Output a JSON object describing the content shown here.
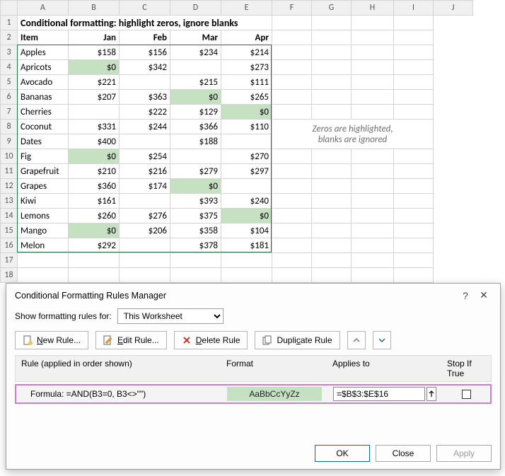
{
  "title": "Conditional formatting: highlight zeros, ignore blanks",
  "cols": [
    "A",
    "B",
    "C",
    "D",
    "E",
    "F",
    "G",
    "H",
    "I",
    "J"
  ],
  "months_header": {
    "item": "Item",
    "jan": "Jan",
    "feb": "Feb",
    "mar": "Mar",
    "apr": "Apr"
  },
  "note_line1": "Zeros are highlighted,",
  "note_line2": "blanks are ignored",
  "rows": [
    {
      "n": 3,
      "item": "Apples",
      "jan": "$158",
      "feb": "$156",
      "mar": "$234",
      "apr": "$214"
    },
    {
      "n": 4,
      "item": "Apricots",
      "jan": "$0",
      "jan_z": true,
      "feb": "$342",
      "mar": "",
      "apr": "$273"
    },
    {
      "n": 5,
      "item": "Avocado",
      "jan": "$221",
      "feb": "",
      "mar": "$215",
      "apr": "$111"
    },
    {
      "n": 6,
      "item": "Bananas",
      "jan": "$207",
      "feb": "$363",
      "mar": "$0",
      "mar_z": true,
      "apr": "$265"
    },
    {
      "n": 7,
      "item": "Cherries",
      "jan": "",
      "feb": "$222",
      "mar": "$129",
      "apr": "$0",
      "apr_z": true
    },
    {
      "n": 8,
      "item": "Coconut",
      "jan": "$331",
      "feb": "$244",
      "mar": "$366",
      "apr": "$110"
    },
    {
      "n": 9,
      "item": "Dates",
      "jan": "$400",
      "feb": "",
      "mar": "$188",
      "apr": ""
    },
    {
      "n": 10,
      "item": "Fig",
      "jan": "$0",
      "jan_z": true,
      "feb": "$254",
      "mar": "",
      "apr": "$270"
    },
    {
      "n": 11,
      "item": "Grapefruit",
      "jan": "$210",
      "feb": "$216",
      "mar": "$279",
      "apr": "$297"
    },
    {
      "n": 12,
      "item": "Grapes",
      "jan": "$360",
      "feb": "$174",
      "mar": "$0",
      "mar_z": true,
      "apr": ""
    },
    {
      "n": 13,
      "item": "Kiwi",
      "jan": "$161",
      "feb": "",
      "mar": "$393",
      "apr": "$240"
    },
    {
      "n": 14,
      "item": "Lemons",
      "jan": "$260",
      "feb": "$276",
      "mar": "$375",
      "apr": "$0",
      "apr_z": true
    },
    {
      "n": 15,
      "item": "Mango",
      "jan": "$0",
      "jan_z": true,
      "feb": "$206",
      "mar": "$358",
      "apr": "$104"
    },
    {
      "n": 16,
      "item": "Melon",
      "jan": "$292",
      "feb": "",
      "mar": "$378",
      "apr": "$181"
    }
  ],
  "dialog": {
    "title": "Conditional Formatting Rules Manager",
    "show_label": "Show formatting rules for:",
    "show_value": "This Worksheet",
    "new_rule": "New Rule...",
    "edit_rule": "Edit Rule...",
    "delete_rule": "Delete Rule",
    "duplicate_rule": "Duplicate Rule",
    "hdr_rule": "Rule (applied in order shown)",
    "hdr_format": "Format",
    "hdr_applies": "Applies to",
    "hdr_stop": "Stop If True",
    "formula": "Formula: =AND(B3=0, B3<>\"\")",
    "preview": "AaBbCcYyZz",
    "applies_to": "=$B$3:$E$16",
    "ok": "OK",
    "close": "Close",
    "apply": "Apply"
  }
}
